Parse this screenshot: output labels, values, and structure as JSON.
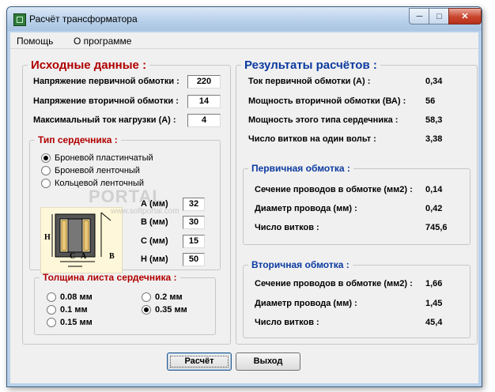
{
  "window": {
    "title": "Расчёт трансформатора"
  },
  "menu": {
    "help": "Помощь",
    "about": "О программе"
  },
  "input": {
    "title": "Исходные данные :",
    "primary_voltage": {
      "label": "Напряжение первичной обмотки :",
      "value": "220"
    },
    "secondary_voltage": {
      "label": "Напряжение вторичной обмотки :",
      "value": "14"
    },
    "max_current": {
      "label": "Максимальный ток нагрузки  (А)  :",
      "value": "4"
    }
  },
  "core_type": {
    "title": "Тип сердечника :",
    "options": [
      "Броневой пластинчатый",
      "Броневой ленточный",
      "Кольцевой ленточный"
    ],
    "selected_index": 0
  },
  "dims": {
    "a": {
      "label": "А (мм)",
      "value": "32"
    },
    "b": {
      "label": "В (мм)",
      "value": "30"
    },
    "c": {
      "label": "С (мм)",
      "value": "15"
    },
    "h": {
      "label": "Н (мм)",
      "value": "50"
    },
    "diagram": {
      "h": "Н",
      "c": "С",
      "a": "А",
      "b": "В"
    }
  },
  "sheet": {
    "title": "Толщина листа сердечника :",
    "options": [
      "0.08 мм",
      "0.1 мм",
      "0.15 мм",
      "0.2 мм",
      "0.35 мм"
    ],
    "selected": "0.35 мм"
  },
  "results": {
    "title": "Результаты расчётов :",
    "primary_current": {
      "label": "Ток первичной обмотки (А) :",
      "value": "0,34"
    },
    "secondary_power": {
      "label": "Мощность вторичной обмотки (ВА) :",
      "value": "56"
    },
    "core_power": {
      "label": "Мощность  этого типа сердечника :",
      "value": "58,3"
    },
    "turns_per_volt": {
      "label": "Число витков на один вольт :",
      "value": "3,38"
    }
  },
  "primary_winding": {
    "title": "Первичная обмотка :",
    "section": {
      "label": "Сечение проводов в обмотке (мм2) :",
      "value": "0,14"
    },
    "diameter": {
      "label": "Диаметр провода (мм) :",
      "value": "0,42"
    },
    "turns": {
      "label": "Число витков :",
      "value": "745,6"
    }
  },
  "secondary_winding": {
    "title": "Вторичная обмотка :",
    "section": {
      "label": "Сечение проводов в обмотке (мм2) :",
      "value": "1,66"
    },
    "diameter": {
      "label": "Диаметр провода (мм) :",
      "value": "1,45"
    },
    "turns": {
      "label": "Число витков :",
      "value": "45,4"
    }
  },
  "buttons": {
    "calc": "Расчёт",
    "exit": "Выход"
  },
  "watermark": {
    "main": "PORTAL",
    "site": "www.softportal.com"
  }
}
